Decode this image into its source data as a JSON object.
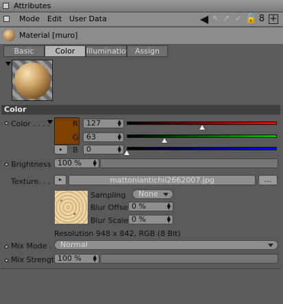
{
  "window": {
    "title": "Attributes"
  },
  "menu": {
    "items": [
      "Mode",
      "Edit",
      "User Data"
    ]
  },
  "material": {
    "name": "Material [muro]"
  },
  "tabs": [
    "Basic",
    "Color",
    "Illumination",
    "Assign"
  ],
  "active_tab": "Color",
  "section": {
    "title": "Color"
  },
  "color": {
    "label": "Color . . . .",
    "swatch": "#7f3f00",
    "channels": [
      {
        "name": "R",
        "value": "127",
        "fraction": 0.5
      },
      {
        "name": "G",
        "value": "63",
        "fraction": 0.25
      },
      {
        "name": "B",
        "value": "0",
        "fraction": 0.0
      }
    ]
  },
  "brightness": {
    "label": "Brightness",
    "value": "100 %"
  },
  "texture": {
    "label": "Texture. . . .",
    "filename": "mattoniantichii2662007.jpg",
    "browse": "...",
    "sampling_label": "Sampling",
    "sampling_value": "None",
    "blur_offset_label": "Blur Offset",
    "blur_offset_value": "0 %",
    "blur_scale_label": "Blur Scale",
    "blur_scale_value": "0 %",
    "resolution": "Resolution 948 x 842, RGB (8 Bit)"
  },
  "mix_mode": {
    "label": "Mix Mode . .",
    "value": "Normal"
  },
  "mix_strength": {
    "label": "Mix Strength",
    "value": "100 %"
  }
}
